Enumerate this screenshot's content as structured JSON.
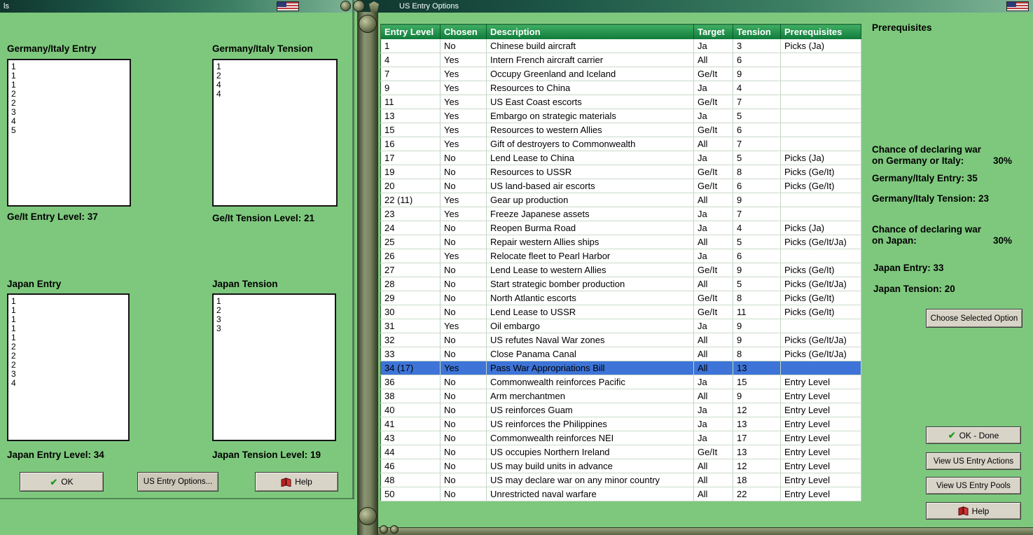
{
  "colors": {
    "background_green": "#7ec87e",
    "titlebar_dark": "#10362e",
    "titlebar_light": "#7fb596",
    "table_header_green": "#1f9148",
    "selected_row_blue": "#3e74d8",
    "button_face": "#d8d4c8"
  },
  "left_window": {
    "titlebar": {
      "title": "ls"
    },
    "labels": {
      "ge_entry": "Germany/Italy Entry",
      "ge_tension": "Germany/Italy Tension",
      "japan_entry": "Japan Entry",
      "japan_tension": "Japan Tension"
    },
    "listboxes": {
      "ge_entry": [
        "1",
        "1",
        "1",
        "2",
        "2",
        "3",
        "4",
        "5"
      ],
      "ge_tension": [
        "1",
        "2",
        "4",
        "4"
      ],
      "japan_entry": [
        "1",
        "1",
        "1",
        "1",
        "1",
        "2",
        "2",
        "2",
        "3",
        "4"
      ],
      "japan_tension": [
        "1",
        "2",
        "3",
        "3"
      ]
    },
    "levels": {
      "ge_entry": "Ge/It Entry Level: 37",
      "ge_tension": "Ge/It Tension Level: 21",
      "japan_entry": "Japan Entry Level: 34",
      "japan_tension": "Japan Tension Level: 19"
    },
    "buttons": {
      "ok": "OK",
      "us_entry_options": "US Entry Options...",
      "help": "Help"
    }
  },
  "right_window": {
    "titlebar": {
      "title": "US Entry Options"
    },
    "table": {
      "headers": [
        "Entry Level",
        "Chosen",
        "Description",
        "Target",
        "Tension",
        "Prerequisites"
      ],
      "selected_index": 23,
      "rows": [
        [
          "1",
          "No",
          "Chinese build aircraft",
          "Ja",
          "3",
          "Picks (Ja)"
        ],
        [
          "4",
          "Yes",
          "Intern French aircraft carrier",
          "All",
          "6",
          ""
        ],
        [
          "7",
          "Yes",
          "Occupy Greenland and Iceland",
          "Ge/It",
          "9",
          ""
        ],
        [
          "9",
          "Yes",
          "Resources to China",
          "Ja",
          "4",
          ""
        ],
        [
          "11",
          "Yes",
          "US East Coast escorts",
          "Ge/It",
          "7",
          ""
        ],
        [
          "13",
          "Yes",
          "Embargo on strategic materials",
          "Ja",
          "5",
          ""
        ],
        [
          "15",
          "Yes",
          "Resources to western Allies",
          "Ge/It",
          "6",
          ""
        ],
        [
          "16",
          "Yes",
          "Gift of destroyers to Commonwealth",
          "All",
          "7",
          ""
        ],
        [
          "17",
          "No",
          "Lend Lease to China",
          "Ja",
          "5",
          "Picks (Ja)"
        ],
        [
          "19",
          "No",
          "Resources to USSR",
          "Ge/It",
          "8",
          "Picks (Ge/It)"
        ],
        [
          "20",
          "No",
          "US land-based air escorts",
          "Ge/It",
          "6",
          "Picks (Ge/It)"
        ],
        [
          "22 (11)",
          "Yes",
          "Gear up production",
          "All",
          "9",
          ""
        ],
        [
          "23",
          "Yes",
          "Freeze Japanese assets",
          "Ja",
          "7",
          ""
        ],
        [
          "24",
          "No",
          "Reopen Burma Road",
          "Ja",
          "4",
          "Picks (Ja)"
        ],
        [
          "25",
          "No",
          "Repair western Allies ships",
          "All",
          "5",
          "Picks (Ge/It/Ja)"
        ],
        [
          "26",
          "Yes",
          "Relocate fleet to Pearl Harbor",
          "Ja",
          "6",
          ""
        ],
        [
          "27",
          "No",
          "Lend Lease to western Allies",
          "Ge/It",
          "9",
          "Picks (Ge/It)"
        ],
        [
          "28",
          "No",
          "Start strategic bomber production",
          "All",
          "5",
          "Picks (Ge/It/Ja)"
        ],
        [
          "29",
          "No",
          "North Atlantic escorts",
          "Ge/It",
          "8",
          "Picks (Ge/It)"
        ],
        [
          "30",
          "No",
          "Lend Lease to USSR",
          "Ge/It",
          "11",
          "Picks (Ge/It)"
        ],
        [
          "31",
          "Yes",
          "Oil embargo",
          "Ja",
          "9",
          ""
        ],
        [
          "32",
          "No",
          "US refutes Naval War zones",
          "All",
          "9",
          "Picks (Ge/It/Ja)"
        ],
        [
          "33",
          "No",
          "Close Panama Canal",
          "All",
          "8",
          "Picks (Ge/It/Ja)"
        ],
        [
          "34 (17)",
          "Yes",
          "Pass War Appropriations Bill",
          "All",
          "13",
          ""
        ],
        [
          "36",
          "No",
          "Commonwealth reinforces Pacific",
          "Ja",
          "15",
          "Entry Level"
        ],
        [
          "38",
          "No",
          "Arm merchantmen",
          "All",
          "9",
          "Entry Level"
        ],
        [
          "40",
          "No",
          "US reinforces Guam",
          "Ja",
          "12",
          "Entry Level"
        ],
        [
          "41",
          "No",
          "US reinforces the Philippines",
          "Ja",
          "13",
          "Entry Level"
        ],
        [
          "43",
          "No",
          "Commonwealth reinforces NEI",
          "Ja",
          "17",
          "Entry Level"
        ],
        [
          "44",
          "No",
          "US occupies Northern Ireland",
          "Ge/It",
          "13",
          "Entry Level"
        ],
        [
          "46",
          "No",
          "US may build units in advance",
          "All",
          "12",
          "Entry Level"
        ],
        [
          "48",
          "No",
          "US may declare war on any minor country",
          "All",
          "18",
          "Entry Level"
        ],
        [
          "50",
          "No",
          "Unrestricted naval warfare",
          "All",
          "22",
          "Entry Level"
        ]
      ]
    },
    "side_panel": {
      "title": "Prerequisites",
      "germany_chance_line1": "Chance of declaring war",
      "germany_chance_line2": "on Germany or Italy:",
      "germany_chance_value": "30%",
      "germany_entry": "Germany/Italy Entry: 35",
      "germany_tension": "Germany/Italy Tension: 23",
      "japan_chance_line1": "Chance of declaring war",
      "japan_chance_line2": "on Japan:",
      "japan_chance_value": "30%",
      "japan_entry": "Japan Entry: 33",
      "japan_tension": "Japan Tension: 20",
      "choose_button": "Choose Selected Option"
    },
    "buttons": {
      "ok_done": "OK - Done",
      "view_actions": "View US Entry Actions",
      "view_pools": "View US Entry Pools",
      "help": "Help"
    }
  }
}
